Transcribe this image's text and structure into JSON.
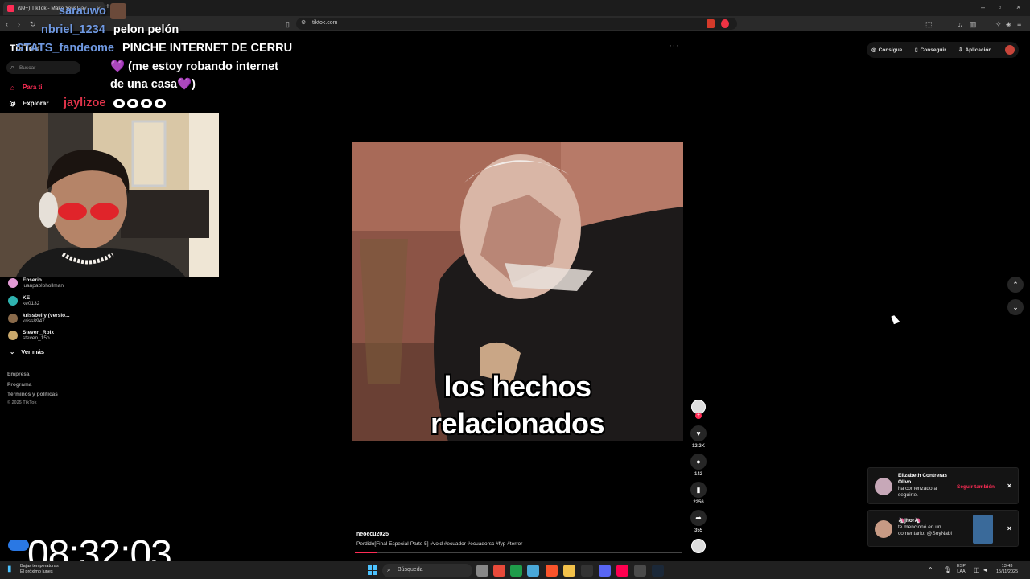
{
  "browser": {
    "tab_title": "(99+) TikTok - Make Your Day",
    "tab_close": "×",
    "new_tab": "+",
    "url": "tiktok.com",
    "window_controls": [
      "–",
      "▫",
      "×"
    ]
  },
  "chat": [
    {
      "user": "sarauwo",
      "message": ""
    },
    {
      "user": "nbriel_1234",
      "message": "pelon pelón"
    },
    {
      "user": "STATS_fandeome",
      "message": "PINCHE INTERNET DE CERRU"
    },
    {
      "user": "",
      "message": "(me estoy robando internet",
      "heart_before": "💜"
    },
    {
      "user": "",
      "message": "de una casa",
      "heart_after": "💜",
      "tail": ")"
    },
    {
      "user": "jaylizoe",
      "message": ""
    }
  ],
  "sidebar": {
    "logo": "TikTok",
    "search_placeholder": "Buscar",
    "nav": [
      {
        "label": "Para ti",
        "icon": "home-icon",
        "active": true
      },
      {
        "label": "Explorar",
        "icon": "compass-icon",
        "active": false
      }
    ],
    "following": [
      {
        "name": "Enserio",
        "username": "juanpablohollman",
        "color": "#e39bd6"
      },
      {
        "name": "KE",
        "username": "ke0132",
        "color": "#2fb3b0"
      },
      {
        "name": "krissbelly (versió...",
        "username": "kriss8947",
        "color": "#8a6a4a"
      },
      {
        "name": "Steven_Rblx",
        "username": "steven_15o",
        "color": "#c9a86b"
      }
    ],
    "see_more": "Ver más",
    "footer_links": [
      "Empresa",
      "Programa",
      "Términos y políticas"
    ],
    "copyright": "© 2025 TikTok"
  },
  "video": {
    "caption_line1": "los hechos",
    "caption_line2": "relacionados",
    "author": "neoecu2025",
    "description": "Perdido[Final Especial-Parte 5] #void #ecuador #ecuadorsc #fyp #terror",
    "progress": 0.07,
    "more": "···",
    "actions": [
      {
        "icon": "heart-icon",
        "count": "12.2K"
      },
      {
        "icon": "comment-icon",
        "count": "142"
      },
      {
        "icon": "bookmark-icon",
        "count": "2256"
      },
      {
        "icon": "share-icon",
        "count": "355"
      }
    ]
  },
  "top_buttons": [
    "Consigue ...",
    "Conseguir ...",
    "Aplicación ..."
  ],
  "notifications": [
    {
      "name": "Elizabeth Contreras Olivo",
      "text": "ha comenzado a seguirte.",
      "action": "Seguir también",
      "close": "×"
    },
    {
      "name": "🦄jhor🦄",
      "text": "te mencionó en un comentario: @SoyNabi",
      "close": "×"
    }
  ],
  "overlay_clock": "08:32:03",
  "taskbar": {
    "weather_line1": "Bajas temperaturas",
    "weather_line2": "El próximo lunes",
    "search": "Búsqueda",
    "lang1": "ESP",
    "lang2": "LAA",
    "time": "13:43",
    "date": "15/11/2025"
  },
  "colors": {
    "accent": "#fe2c55",
    "chat_user": "#6f98e0",
    "windows_blue": "#4cc2ff"
  }
}
